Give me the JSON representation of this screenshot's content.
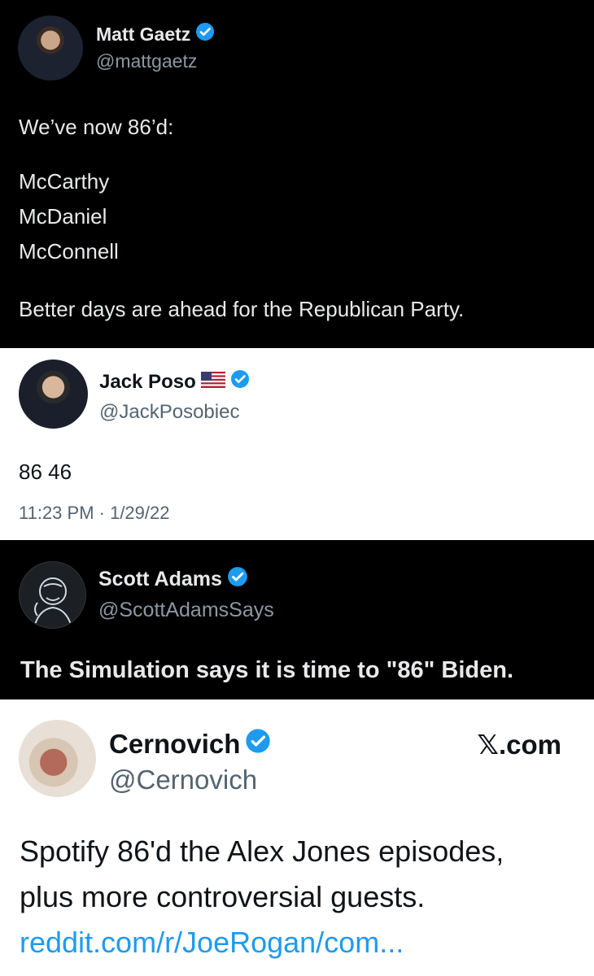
{
  "tweets": [
    {
      "name": "Matt Gaetz",
      "handle": "@mattgaetz",
      "verified": true,
      "lines": [
        "We’ve now 86’d:",
        "McCarthy",
        "McDaniel",
        "McConnell",
        "Better days are ahead for the Republican Party."
      ]
    },
    {
      "name": "Jack Poso",
      "flag": "us-flag-icon",
      "handle": "@JackPosobiec",
      "verified": true,
      "lines": [
        "86 46"
      ],
      "meta": "11:23 PM · 1/29/22"
    },
    {
      "name": "Scott Adams",
      "handle": "@ScottAdamsSays",
      "verified": true,
      "lines": [
        "The Simulation says it is time to \"86\" Biden."
      ]
    },
    {
      "name": "Cernovich",
      "handle": "@Cernovich",
      "verified": true,
      "source": "𝕏.com",
      "lines": [
        "Spotify 86'd the Alex Jones episodes,",
        "plus more controversial guests."
      ],
      "link": "reddit.com/r/JoeRogan/com..."
    }
  ],
  "colors": {
    "verified_blue": "#1d9bf0",
    "dark_bg": "#000000",
    "light_bg": "#ffffff",
    "link": "#1d9bf0"
  }
}
